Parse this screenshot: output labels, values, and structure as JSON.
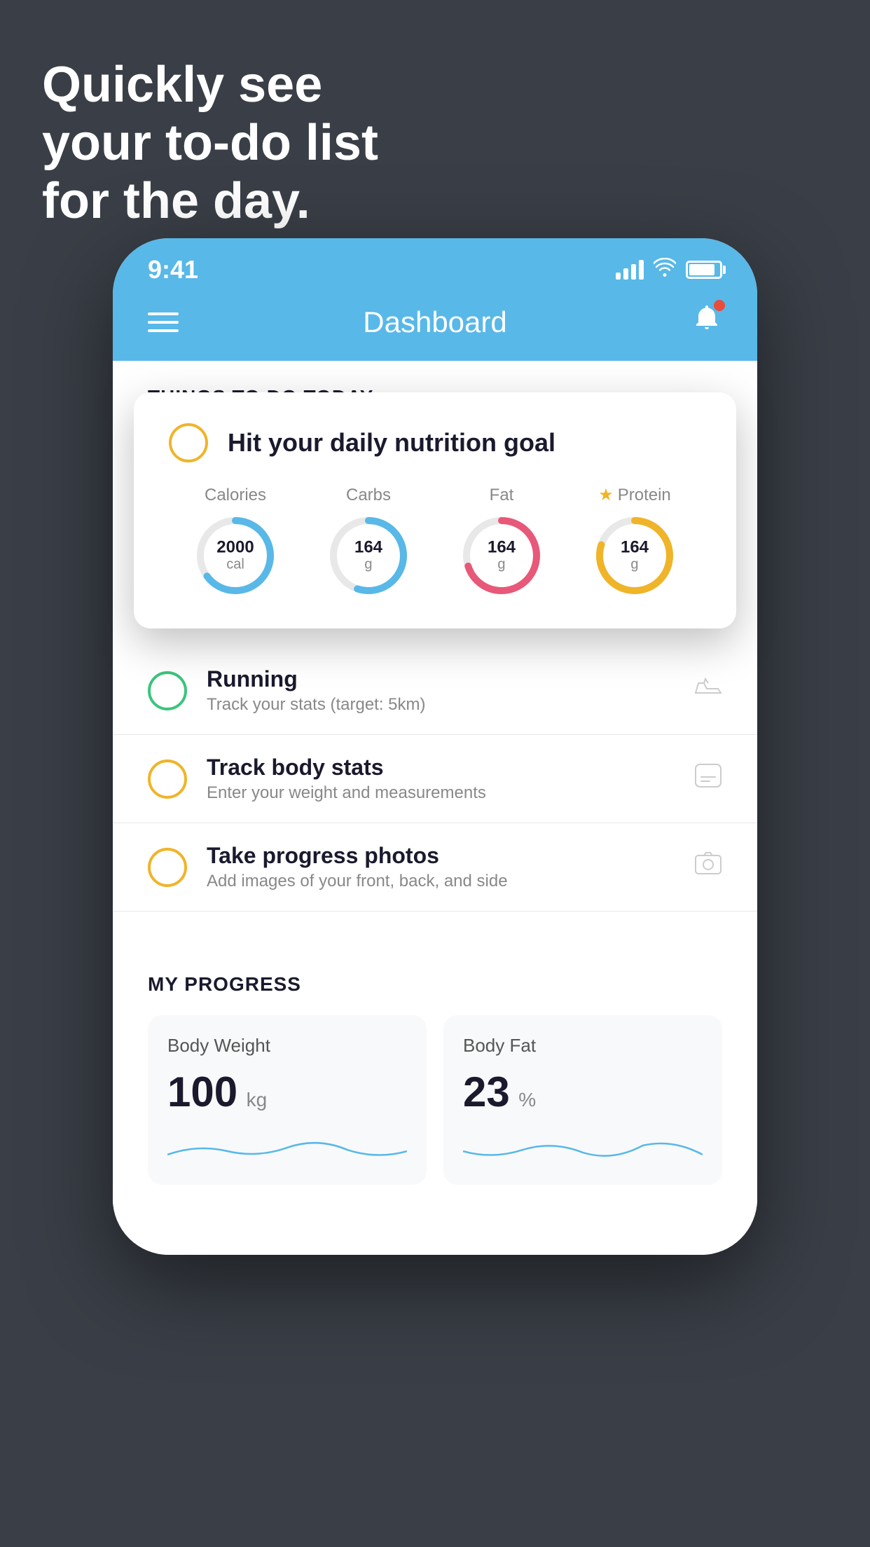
{
  "hero": {
    "line1": "Quickly see",
    "line2": "your to-do list",
    "line3": "for the day."
  },
  "statusBar": {
    "time": "9:41"
  },
  "header": {
    "title": "Dashboard"
  },
  "thingsToday": {
    "sectionLabel": "THINGS TO DO TODAY"
  },
  "nutritionCard": {
    "mainLabel": "Hit your daily nutrition goal",
    "calories": {
      "label": "Calories",
      "value": "2000",
      "unit": "cal",
      "color": "#58b8e8",
      "percent": 65
    },
    "carbs": {
      "label": "Carbs",
      "value": "164",
      "unit": "g",
      "color": "#58b8e8",
      "percent": 55
    },
    "fat": {
      "label": "Fat",
      "value": "164",
      "unit": "g",
      "color": "#e85878",
      "percent": 70
    },
    "protein": {
      "label": "Protein",
      "value": "164",
      "unit": "g",
      "color": "#f0b429",
      "percent": 80,
      "starred": true
    }
  },
  "todoItems": [
    {
      "title": "Running",
      "subtitle": "Track your stats (target: 5km)",
      "checkColor": "green",
      "iconType": "shoe"
    },
    {
      "title": "Track body stats",
      "subtitle": "Enter your weight and measurements",
      "checkColor": "yellow",
      "iconType": "scale"
    },
    {
      "title": "Take progress photos",
      "subtitle": "Add images of your front, back, and side",
      "checkColor": "yellow",
      "iconType": "photo"
    }
  ],
  "progressSection": {
    "sectionLabel": "MY PROGRESS",
    "bodyWeight": {
      "label": "Body Weight",
      "value": "100",
      "unit": "kg"
    },
    "bodyFat": {
      "label": "Body Fat",
      "value": "23",
      "unit": "%"
    }
  }
}
